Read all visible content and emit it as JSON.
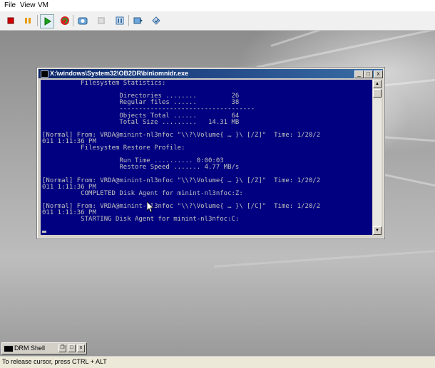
{
  "menu": {
    "file": "File",
    "view": "View",
    "vm": "VM"
  },
  "toolbar_icons": [
    "stop-icon",
    "pause-icon",
    "play-icon",
    "reset-icon",
    "snapshot-icon",
    "revert-icon",
    "settings-icon",
    "send-keys-icon",
    "ctrl-alt-del-icon"
  ],
  "console_window": {
    "title": "X:\\windows\\System32\\OB2DR\\bin\\omnidr.exe",
    "min_label": "_",
    "max_label": "□",
    "close_label": "x",
    "lines": [
      "          Filesystem Statistics:",
      "",
      "                    Directories ........         26",
      "                    Regular files ......         38",
      "                    -----------------------------------",
      "                    Objects Total ......         64",
      "                    Total Size .........   14.31 MB",
      "",
      "[Normal] From: VRDA@minint-nl3nfoc \"\\\\?\\Volume{ … }\\ [/Z]\"  Time: 1/20/2",
      "011 1:11:36 PM",
      "          Filesystem Restore Profile:",
      "",
      "                    Run Time .......... 0:00:03",
      "                    Restore Speed ....... 4.77 MB/s",
      "",
      "[Normal] From: VRDA@minint-nl3nfoc \"\\\\?\\Volume{ … }\\ [/Z]\"  Time: 1/20/2",
      "011 1:11:36 PM",
      "          COMPLETED Disk Agent for minint-nl3nfoc:Z:",
      "",
      "[Normal] From: VRDA@minint-nl3nfoc \"\\\\?\\Volume{ … }\\ [/C]\"  Time: 1/20/2",
      "011 1:11:36 PM",
      "          STARTING Disk Agent for minint-nl3nfoc:C:"
    ]
  },
  "taskbar": {
    "label": "DRM Shell"
  },
  "status": {
    "text": "To release cursor, press CTRL + ALT"
  }
}
